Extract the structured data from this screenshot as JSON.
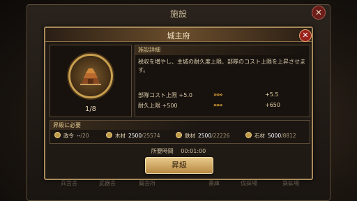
{
  "outer": {
    "title": "施設",
    "close": "✕",
    "tabs": [
      "兵営舎",
      "武器舎",
      "厩舎所",
      "書庫",
      "伐採場",
      "鉄鉱場"
    ]
  },
  "dialog": {
    "title": "城主府",
    "close": "✕",
    "level": "1/8",
    "detail_label": "施設詳細",
    "description": "税収を増やし、主城の耐久度上限、部隊のコスト上限を上昇させます。",
    "stats": [
      {
        "name": "部隊コスト上限 +5.0",
        "arrow": "»»»",
        "new": "+5.5"
      },
      {
        "name": "耐久上限 +500",
        "arrow": "»»»",
        "new": "+650"
      }
    ],
    "requirements_title": "昇級に必要",
    "requirements": [
      {
        "icon": "decree-icon",
        "name": "政令",
        "have": "--",
        "need": "/20"
      },
      {
        "icon": "wood-icon",
        "name": "木材",
        "have": "2500",
        "need": "/25574"
      },
      {
        "icon": "iron-icon",
        "name": "鉄材",
        "have": "2500",
        "need": "/22226"
      },
      {
        "icon": "stone-icon",
        "name": "石材",
        "have": "5000",
        "need": "/8812"
      }
    ],
    "time_label": "所要時間",
    "time_value": "00:01:00",
    "upgrade_label": "昇級"
  },
  "colors": {
    "accent": "#c8a050",
    "button": "#d9b470",
    "close": "#9a221c"
  }
}
